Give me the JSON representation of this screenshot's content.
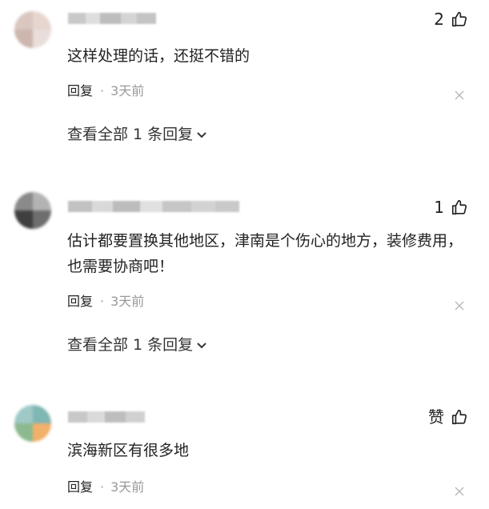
{
  "comments": [
    {
      "likes": "2",
      "text": "这样处理的话，还挺不错的",
      "reply_label": "回复",
      "separator": "·",
      "time": "3天前",
      "view_all": "查看全部 1 条回复"
    },
    {
      "likes": "1",
      "text": "估计都要置换其他地区，津南是个伤心的地方，装修费用，也需要协商吧！",
      "reply_label": "回复",
      "separator": "·",
      "time": "3天前",
      "view_all": "查看全部 1 条回复"
    },
    {
      "likes": "赞",
      "text": "滨海新区有很多地",
      "reply_label": "回复",
      "separator": "·",
      "time": "3天前"
    }
  ],
  "icons": {
    "like": "thumbs-up-icon",
    "close": "close-icon",
    "expand": "chevron-down-icon"
  }
}
